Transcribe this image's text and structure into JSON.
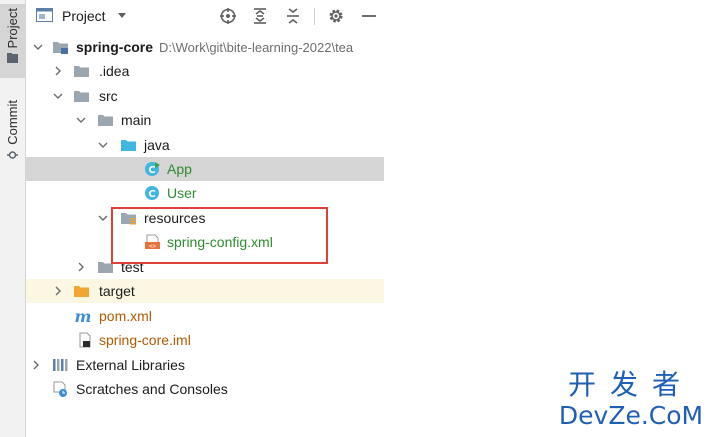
{
  "sidebar_tabs": {
    "project": "Project",
    "commit": "Commit"
  },
  "panel": {
    "title": "Project"
  },
  "tree": {
    "root_name": "spring-core",
    "root_path": "D:\\Work\\git\\bite-learning-2022\\tea",
    "idea": ".idea",
    "src": "src",
    "main": "main",
    "java": "java",
    "app": "App",
    "user": "User",
    "resources": "resources",
    "spring_config": "spring-config.xml",
    "test": "test",
    "target": "target",
    "pom": "pom.xml",
    "iml": "spring-core.iml",
    "external_libraries": "External Libraries",
    "scratches": "Scratches and Consoles"
  },
  "icons": {
    "header": [
      "target-icon",
      "expand-all-icon",
      "collapse-all-icon",
      "gear-icon",
      "minimize-icon"
    ],
    "folder_color": "#9aa7b0",
    "source_folder_color": "#40b6e0",
    "excluded_folder_color": "#f0a732",
    "class_color": "#40b6e0"
  },
  "watermark": {
    "cn": "开发者",
    "en": "DevZe.CoM"
  }
}
